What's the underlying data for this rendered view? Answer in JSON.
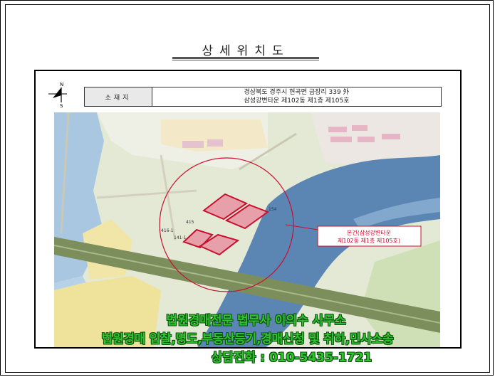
{
  "title": "상세위치도",
  "compass": {
    "north": "N",
    "south": "S"
  },
  "info": {
    "label": "소재지",
    "address_line1": "경상북도 경주시 현곡면 금장리 339 外",
    "address_line2": "삼성강변타운 제102동 제1층 제105호"
  },
  "callout": {
    "line1": "본건(삼성강변타운",
    "line2": "제102동 제1층 제105호)"
  },
  "map_labels": {
    "lot_154": "154",
    "lot_415": "415",
    "lot_4161": "416-1",
    "lot_1411": "141-1"
  },
  "overlay": {
    "line1": "법원경매전문 법무사 이의수 사무소",
    "line2": "법원경매 입찰,명도,부동산등기,경매신청 및 취하,민사소송",
    "line3": "상담전화 : 010-5435-1721"
  },
  "colors": {
    "overlay_text": "#2fc42f",
    "overlay_outline": "#0b4e0b",
    "subject_fill": "#e8879a",
    "subject_outline": "#c8102e",
    "river": "#5b86b4"
  }
}
